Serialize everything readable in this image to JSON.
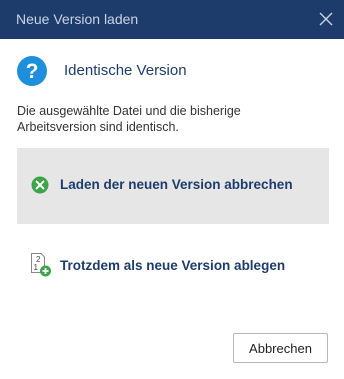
{
  "dialog": {
    "title": "Neue Version laden",
    "close_icon": "close-icon",
    "header_icon": "question-icon",
    "header_text": "Identische Version",
    "description": "Die ausgewählte Datei und die bisherige Arbeitsversion sind identisch.",
    "options": [
      {
        "label": "Laden der neuen Version abbrechen",
        "icon": "cancel-circle-icon",
        "selected": true
      },
      {
        "label": "Trotzdem als neue Version ablegen",
        "icon": "new-version-icon",
        "selected": false
      }
    ],
    "cancel_label": "Abbrechen"
  },
  "colors": {
    "titlebar": "#1e3c6b",
    "accent": "#1e3c6b",
    "question_icon": "#1e8fdc",
    "cancel_icon": "#3da44a",
    "selected_background": "#e6e6e6"
  }
}
